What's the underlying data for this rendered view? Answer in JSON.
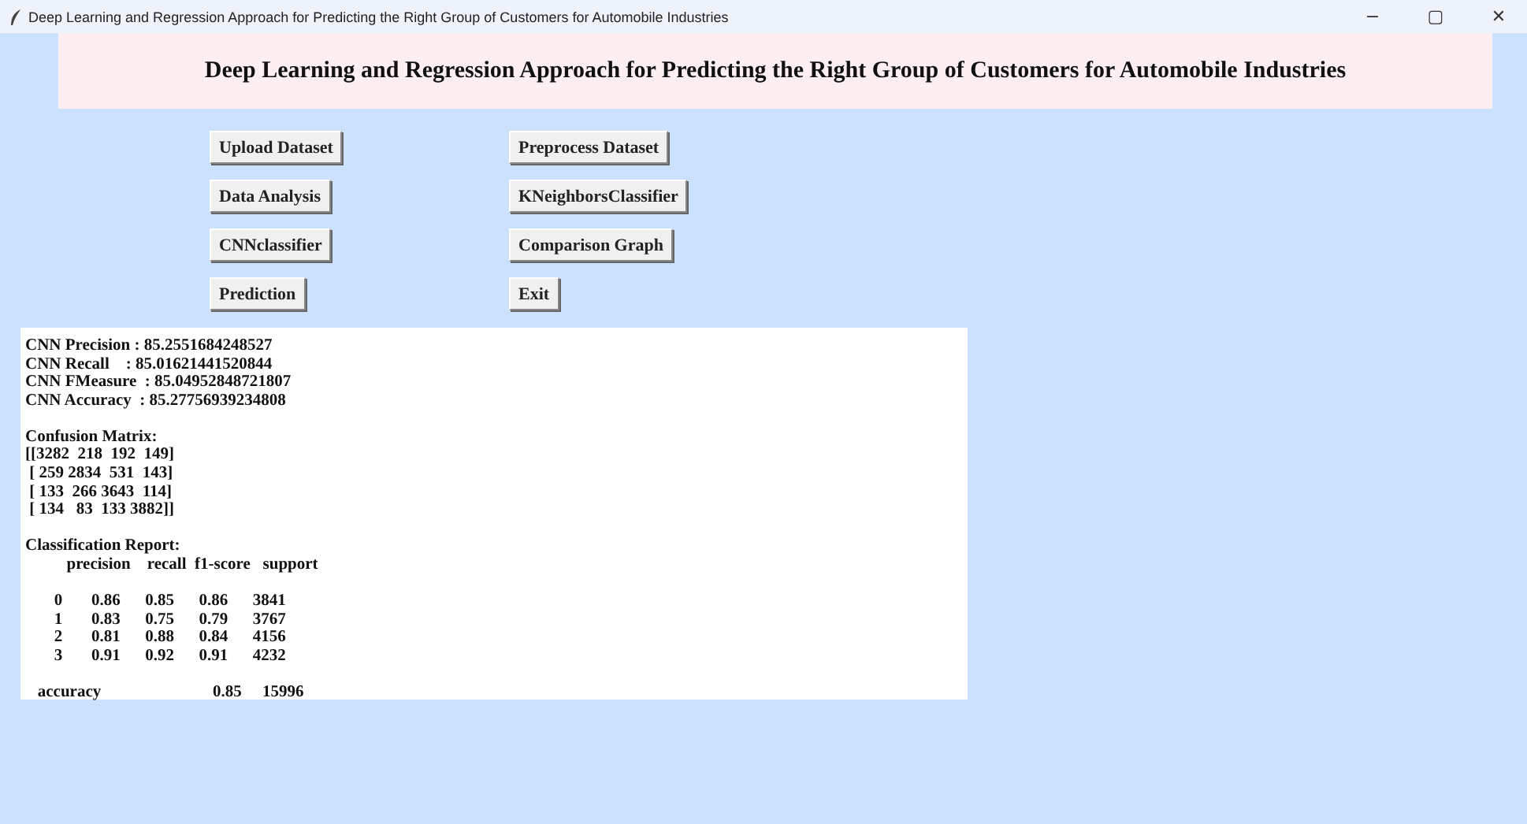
{
  "window": {
    "title": "Deep Learning and Regression Approach for Predicting the Right Group of Customers for Automobile Industries",
    "controls": [
      "−",
      "▢",
      "✕"
    ]
  },
  "heading": "Deep Learning and Regression Approach for Predicting the Right Group of Customers for Automobile Industries",
  "buttons": [
    [
      "Upload Dataset",
      "Preprocess Dataset"
    ],
    [
      "Data Analysis",
      "KNeighborsClassifier"
    ],
    [
      "CNNclassifier",
      "Comparison Graph"
    ],
    [
      "Prediction",
      "Exit"
    ]
  ],
  "output_sections": [
    [
      "CNN Precision : 85.2551684248527",
      "CNN Recall    : 85.01621441520844",
      "CNN FMeasure  : 85.04952848721807",
      "CNN Accuracy  : 85.27756939234808"
    ],
    [
      "Confusion Matrix:",
      "[[3282  218  192  149]",
      " [ 259 2834  531  143]",
      " [ 133  266 3643  114]",
      " [ 134   83  133 3882]]"
    ],
    [
      "Classification Report:",
      "          precision    recall  f1-score   support"
    ],
    [
      "       0       0.86      0.85      0.86      3841",
      "       1       0.83      0.75      0.79      3767",
      "       2       0.81      0.88      0.84      4156",
      "       3       0.91      0.92      0.91      4232"
    ],
    [
      "   accuracy                           0.85     15996"
    ]
  ]
}
